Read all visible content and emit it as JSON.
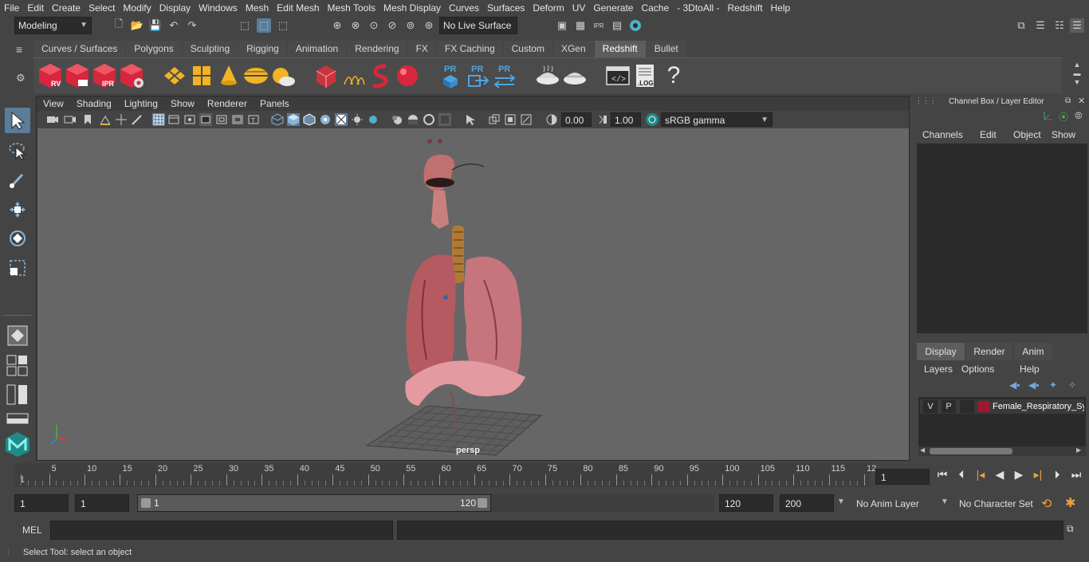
{
  "menubar": [
    "File",
    "Edit",
    "Create",
    "Select",
    "Modify",
    "Display",
    "Windows",
    "Mesh",
    "Edit Mesh",
    "Mesh Tools",
    "Mesh Display",
    "Curves",
    "Surfaces",
    "Deform",
    "UV",
    "Generate",
    "Cache",
    "- 3DtoAll -",
    "Redshift",
    "Help"
  ],
  "statusline": {
    "mode": "Modeling",
    "live_surface": "No Live Surface"
  },
  "shelf_tabs": [
    "Curves / Surfaces",
    "Polygons",
    "Sculpting",
    "Rigging",
    "Animation",
    "Rendering",
    "FX",
    "FX Caching",
    "Custom",
    "XGen",
    "Redshift",
    "Bullet"
  ],
  "shelf_active": "Redshift",
  "shelf_icon_labels": {
    "rv": "RV",
    "ipr": "IPR",
    "pr": "PR",
    "log": ".LOG",
    "help": "?"
  },
  "viewport": {
    "menu": [
      "View",
      "Shading",
      "Lighting",
      "Show",
      "Renderer",
      "Panels"
    ],
    "exposure": "0.00",
    "gamma": "1.00",
    "color_space": "sRGB gamma",
    "camera_label": "persp"
  },
  "channel_box": {
    "title": "Channel Box / Layer Editor",
    "menu": [
      "Channels",
      "Edit",
      "Object",
      "Show"
    ],
    "layer_tabs": [
      "Display",
      "Render",
      "Anim"
    ],
    "layer_tab_active": "Display",
    "layer_menu": [
      "Layers",
      "Options",
      "Help"
    ],
    "layer": {
      "v": "V",
      "p": "P",
      "name": "Female_Respiratory_Sy",
      "color": "#a01830"
    }
  },
  "timeline": {
    "ticks": [
      "1",
      "5",
      "10",
      "15",
      "20",
      "25",
      "30",
      "35",
      "40",
      "45",
      "50",
      "55",
      "60",
      "65",
      "70",
      "75",
      "80",
      "85",
      "90",
      "95",
      "100",
      "105",
      "110",
      "115",
      "12"
    ],
    "current_frame": "1"
  },
  "range": {
    "start": "1",
    "playback_start": "1",
    "slider_start": "1",
    "slider_end": "120",
    "playback_end": "120",
    "end": "200",
    "anim_layer": "No Anim Layer",
    "character_set": "No Character Set"
  },
  "command": {
    "label": "MEL"
  },
  "help_line": "Select Tool: select an object",
  "colors": {
    "bg": "#444444",
    "viewport": "#666666",
    "field": "#2b2b2b",
    "redshift_red": "#d7263d",
    "accent_blue": "#5a8fb8"
  }
}
